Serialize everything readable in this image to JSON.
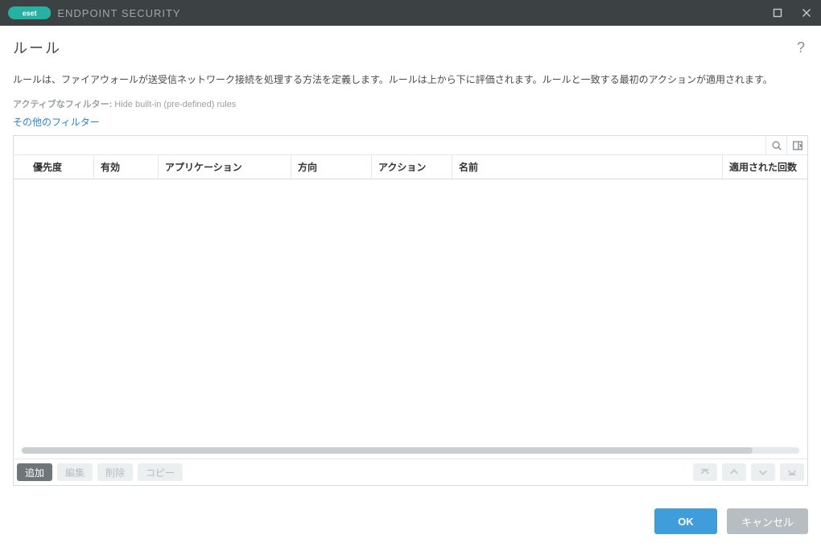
{
  "window": {
    "brand_text": "ENDPOINT SECURITY"
  },
  "page": {
    "title": "ルール",
    "description": "ルールは、ファイアウォールが送受信ネットワーク接続を処理する方法を定義します。ルールは上から下に評価されます。ルールと一致する最初のアクションが適用されます。"
  },
  "filters": {
    "label": "アクティブなフィルター:",
    "value": "Hide built-in (pre-defined) rules",
    "more_link": "その他のフィルター"
  },
  "table": {
    "columns": {
      "priority": "優先度",
      "enabled": "有効",
      "application": "アプリケーション",
      "direction": "方向",
      "action": "アクション",
      "name": "名前",
      "hit_count": "適用された回数"
    },
    "rows": []
  },
  "actions": {
    "add": "追加",
    "edit": "編集",
    "delete": "削除",
    "copy": "コピー"
  },
  "dialog": {
    "ok": "OK",
    "cancel": "キャンセル"
  }
}
